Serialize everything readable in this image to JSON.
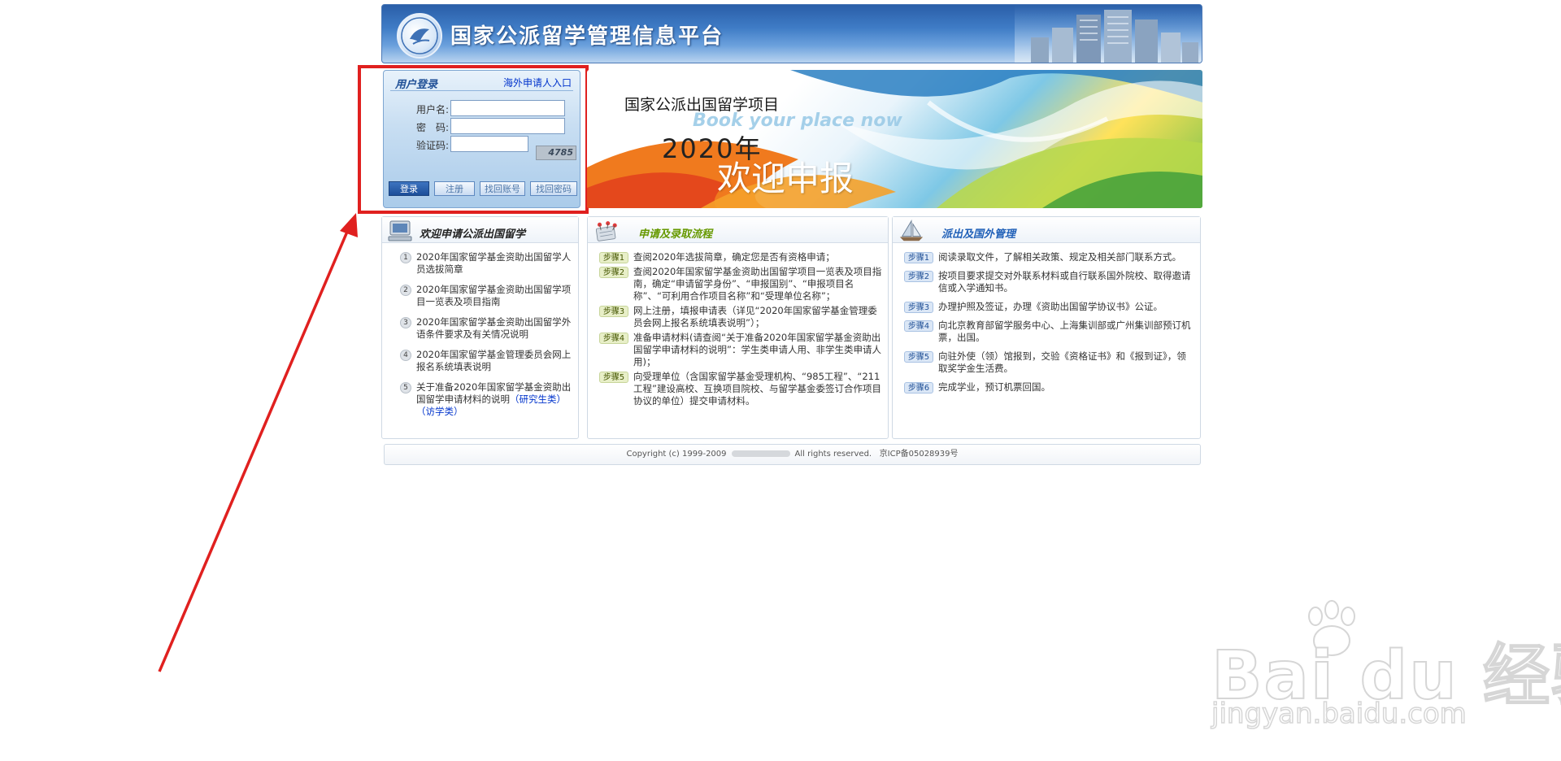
{
  "header": {
    "title": "国家公派留学管理信息平台"
  },
  "login": {
    "heading": "用户登录",
    "overseas_link": "海外申请人入口",
    "username_label": "用户名:",
    "password_label": "密　码:",
    "captcha_label": "验证码:",
    "captcha_code": "4785",
    "buttons": {
      "login": "登录",
      "register": "注册",
      "find_account": "找回账号",
      "find_password": "找回密码"
    }
  },
  "banner": {
    "line1": "国家公派出国留学项目",
    "line2": "Book your place now",
    "year": "2020年",
    "welcome": "欢迎申报"
  },
  "panel_welcome": {
    "title": "欢迎申请公派出国留学",
    "items": [
      {
        "num": "1",
        "text": "2020年国家留学基金资助出国留学人员选拔简章"
      },
      {
        "num": "2",
        "text": "2020年国家留学基金资助出国留学项目一览表及项目指南"
      },
      {
        "num": "3",
        "text": "2020年国家留学基金资助出国留学外语条件要求及有关情况说明"
      },
      {
        "num": "4",
        "text": "2020年国家留学基金管理委员会网上报名系统填表说明"
      },
      {
        "num": "5",
        "text": "关于准备2020年国家留学基金资助出国留学申请材料的说明",
        "link1": "（研究生类）",
        "link2": "（访学类）"
      }
    ]
  },
  "panel_process": {
    "title": "申请及录取流程",
    "steps": [
      {
        "tag": "步骤1",
        "text": "查阅2020年选拔简章，确定您是否有资格申请；"
      },
      {
        "tag": "步骤2",
        "text": "查阅2020年国家留学基金资助出国留学项目一览表及项目指南，确定“申请留学身份”、“申报国别”、“申报项目名称”、“可利用合作项目名称”和“受理单位名称”；"
      },
      {
        "tag": "步骤3",
        "text": "网上注册，填报申请表（详见“2020年国家留学基金管理委员会网上报名系统填表说明”）；"
      },
      {
        "tag": "步骤4",
        "text": "准备申请材料(请查阅“关于准备2020年国家留学基金资助出国留学申请材料的说明”：学生类申请人用、非学生类申请人用)；"
      },
      {
        "tag": "步骤5",
        "text": "向受理单位（含国家留学基金受理机构、“985工程”、“211工程”建设高校、互换项目院校、与留学基金委签订合作项目协议的单位）提交申请材料。"
      }
    ]
  },
  "panel_dispatch": {
    "title": "派出及国外管理",
    "steps": [
      {
        "tag": "步骤1",
        "text": "阅读录取文件，了解相关政策、规定及相关部门联系方式。"
      },
      {
        "tag": "步骤2",
        "text": "按项目要求提交对外联系材料或自行联系国外院校、取得邀请信或入学通知书。"
      },
      {
        "tag": "步骤3",
        "text": "办理护照及签证，办理《资助出国留学协议书》公证。"
      },
      {
        "tag": "步骤4",
        "text": "向北京教育部留学服务中心、上海集训部或广州集训部预订机票，出国。"
      },
      {
        "tag": "步骤5",
        "text": "向驻外使（领）馆报到，交验《资格证书》和《报到证》，领取奖学金生活费。"
      },
      {
        "tag": "步骤6",
        "text": "完成学业，预订机票回国。"
      }
    ]
  },
  "footer": {
    "copyright": "Copyright (c) 1999-2009",
    "rights": "All rights reserved.",
    "icp": "京ICP备05028939号"
  },
  "watermark": {
    "brand": "Bai du 经验",
    "url": "jingyan.baidu.com"
  },
  "colors": {
    "highlight": "#e0201f",
    "header_blue": "#2a5ea8",
    "link_blue": "#0033cc"
  }
}
